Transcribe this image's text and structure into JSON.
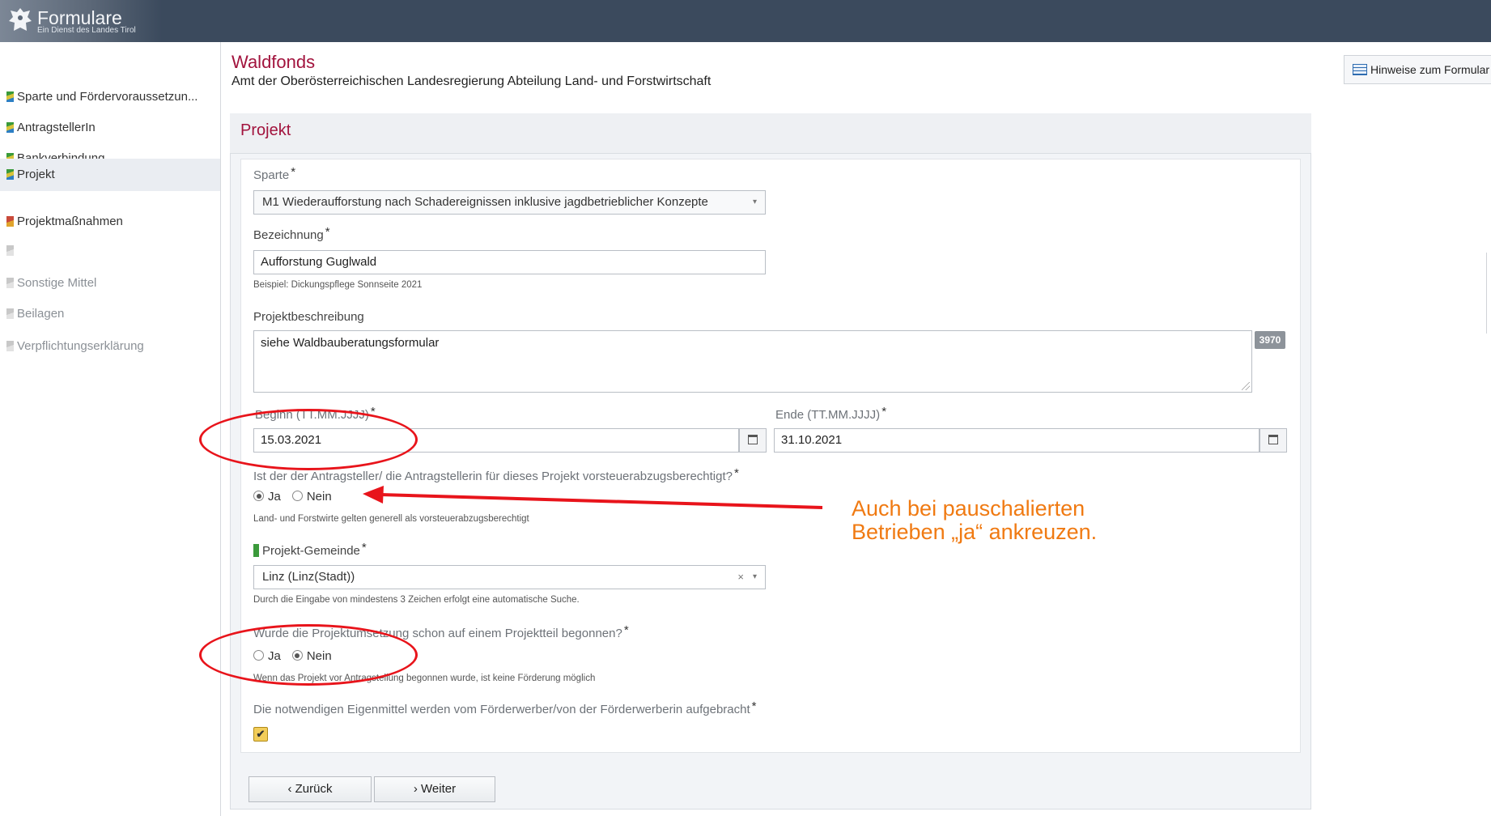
{
  "brand": {
    "title": "Formulare",
    "subtitle": "Ein Dienst des Landes Tirol"
  },
  "sidebar": {
    "items": [
      {
        "label": "Sparte und Fördervoraussetzun...",
        "state": "done"
      },
      {
        "label": "AntragstellerIn",
        "state": "done"
      },
      {
        "label": "Bankverbindung",
        "state": "done"
      },
      {
        "label": "Projekt",
        "state": "active"
      },
      {
        "label": "Projektmaßnahmen",
        "state": "warning"
      },
      {
        "label": "",
        "state": "disabled"
      },
      {
        "label": "Sonstige Mittel",
        "state": "disabled"
      },
      {
        "label": "Beilagen",
        "state": "disabled"
      },
      {
        "label": "Verpflichtungserklärung",
        "state": "disabled"
      }
    ]
  },
  "header": {
    "title": "Waldfonds",
    "subtitle": "Amt der Oberösterreichischen Landesregierung Abteilung Land- und Forstwirtschaft",
    "hint_button": "Hinweise zum Formular"
  },
  "panel": {
    "title": "Projekt"
  },
  "form": {
    "required_mark": "*",
    "sparte": {
      "label": "Sparte",
      "value": "M1 Wiederaufforstung nach Schadereignissen inklusive jagdbetrieblicher Konzepte"
    },
    "bezeichnung": {
      "label": "Bezeichnung",
      "value": "Aufforstung Guglwald",
      "help": "Beispiel: Dickungspflege Sonnseite 2021"
    },
    "beschreibung": {
      "label": "Projektbeschreibung",
      "value": "siehe Waldbauberatungsformular",
      "counter": "3970"
    },
    "beginn": {
      "label": "Beginn (TT.MM.JJJJ)",
      "value": "15.03.2021"
    },
    "ende": {
      "label": "Ende (TT.MM.JJJJ)",
      "value": "31.10.2021"
    },
    "vorsteuer": {
      "question": "Ist der der Antragsteller/ die Antragstellerin für dieses Projekt vorsteuerabzugsberechtigt?",
      "options": [
        "Ja",
        "Nein"
      ],
      "selected": "Ja",
      "help": "Land- und Forstwirte gelten generell als vorsteuerabzugsberechtigt"
    },
    "gemeinde": {
      "label": "Projekt-Gemeinde",
      "value": "Linz (Linz(Stadt))",
      "clear": "×",
      "caret": "▾",
      "help": "Durch die Eingabe von mindestens 3 Zeichen erfolgt eine automatische Suche."
    },
    "begonnen": {
      "question": "Wurde die Projektumsetzung schon auf einem Projektteil begonnen?",
      "options": [
        "Ja",
        "Nein"
      ],
      "selected": "Nein",
      "help": "Wenn das Projekt vor Antragstellung begonnen wurde, ist keine Förderung möglich"
    },
    "eigenmittel": {
      "label": "Die notwendigen Eigenmittel werden vom Förderwerber/von der Förderwerberin aufgebracht",
      "checked": true,
      "checkmark": "✔"
    }
  },
  "buttons": {
    "back": "‹ Zurück",
    "next": "› Weiter"
  },
  "annotation": {
    "line1": "Auch bei pauschalierten",
    "line2": "Betrieben „ja“ ankreuzen.",
    "color": "#f07a12",
    "marker_color": "#e8141b"
  },
  "colors": {
    "accent": "#a2133d",
    "topbar": "#3b4a5d"
  }
}
